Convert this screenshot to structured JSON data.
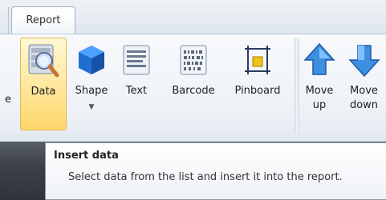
{
  "tabs": {
    "active_label": "Report"
  },
  "ribbon": {
    "clipped_left_label": "e",
    "buttons": [
      {
        "label": "Data",
        "icon": "database-search-icon"
      },
      {
        "label": "Shape",
        "icon": "cube-icon"
      },
      {
        "label": "Text",
        "icon": "text-icon"
      },
      {
        "label": "Barcode",
        "icon": "barcode-icon"
      },
      {
        "label": "Pinboard",
        "icon": "pinboard-icon"
      }
    ],
    "arrange": [
      {
        "label_line1": "Move",
        "label_line2": "up",
        "icon": "arrow-up-icon"
      },
      {
        "label_line1": "Move",
        "label_line2": "down",
        "icon": "arrow-down-icon"
      }
    ]
  },
  "tooltip": {
    "title": "Insert data",
    "body": "Select data from the list and insert it into the report."
  }
}
